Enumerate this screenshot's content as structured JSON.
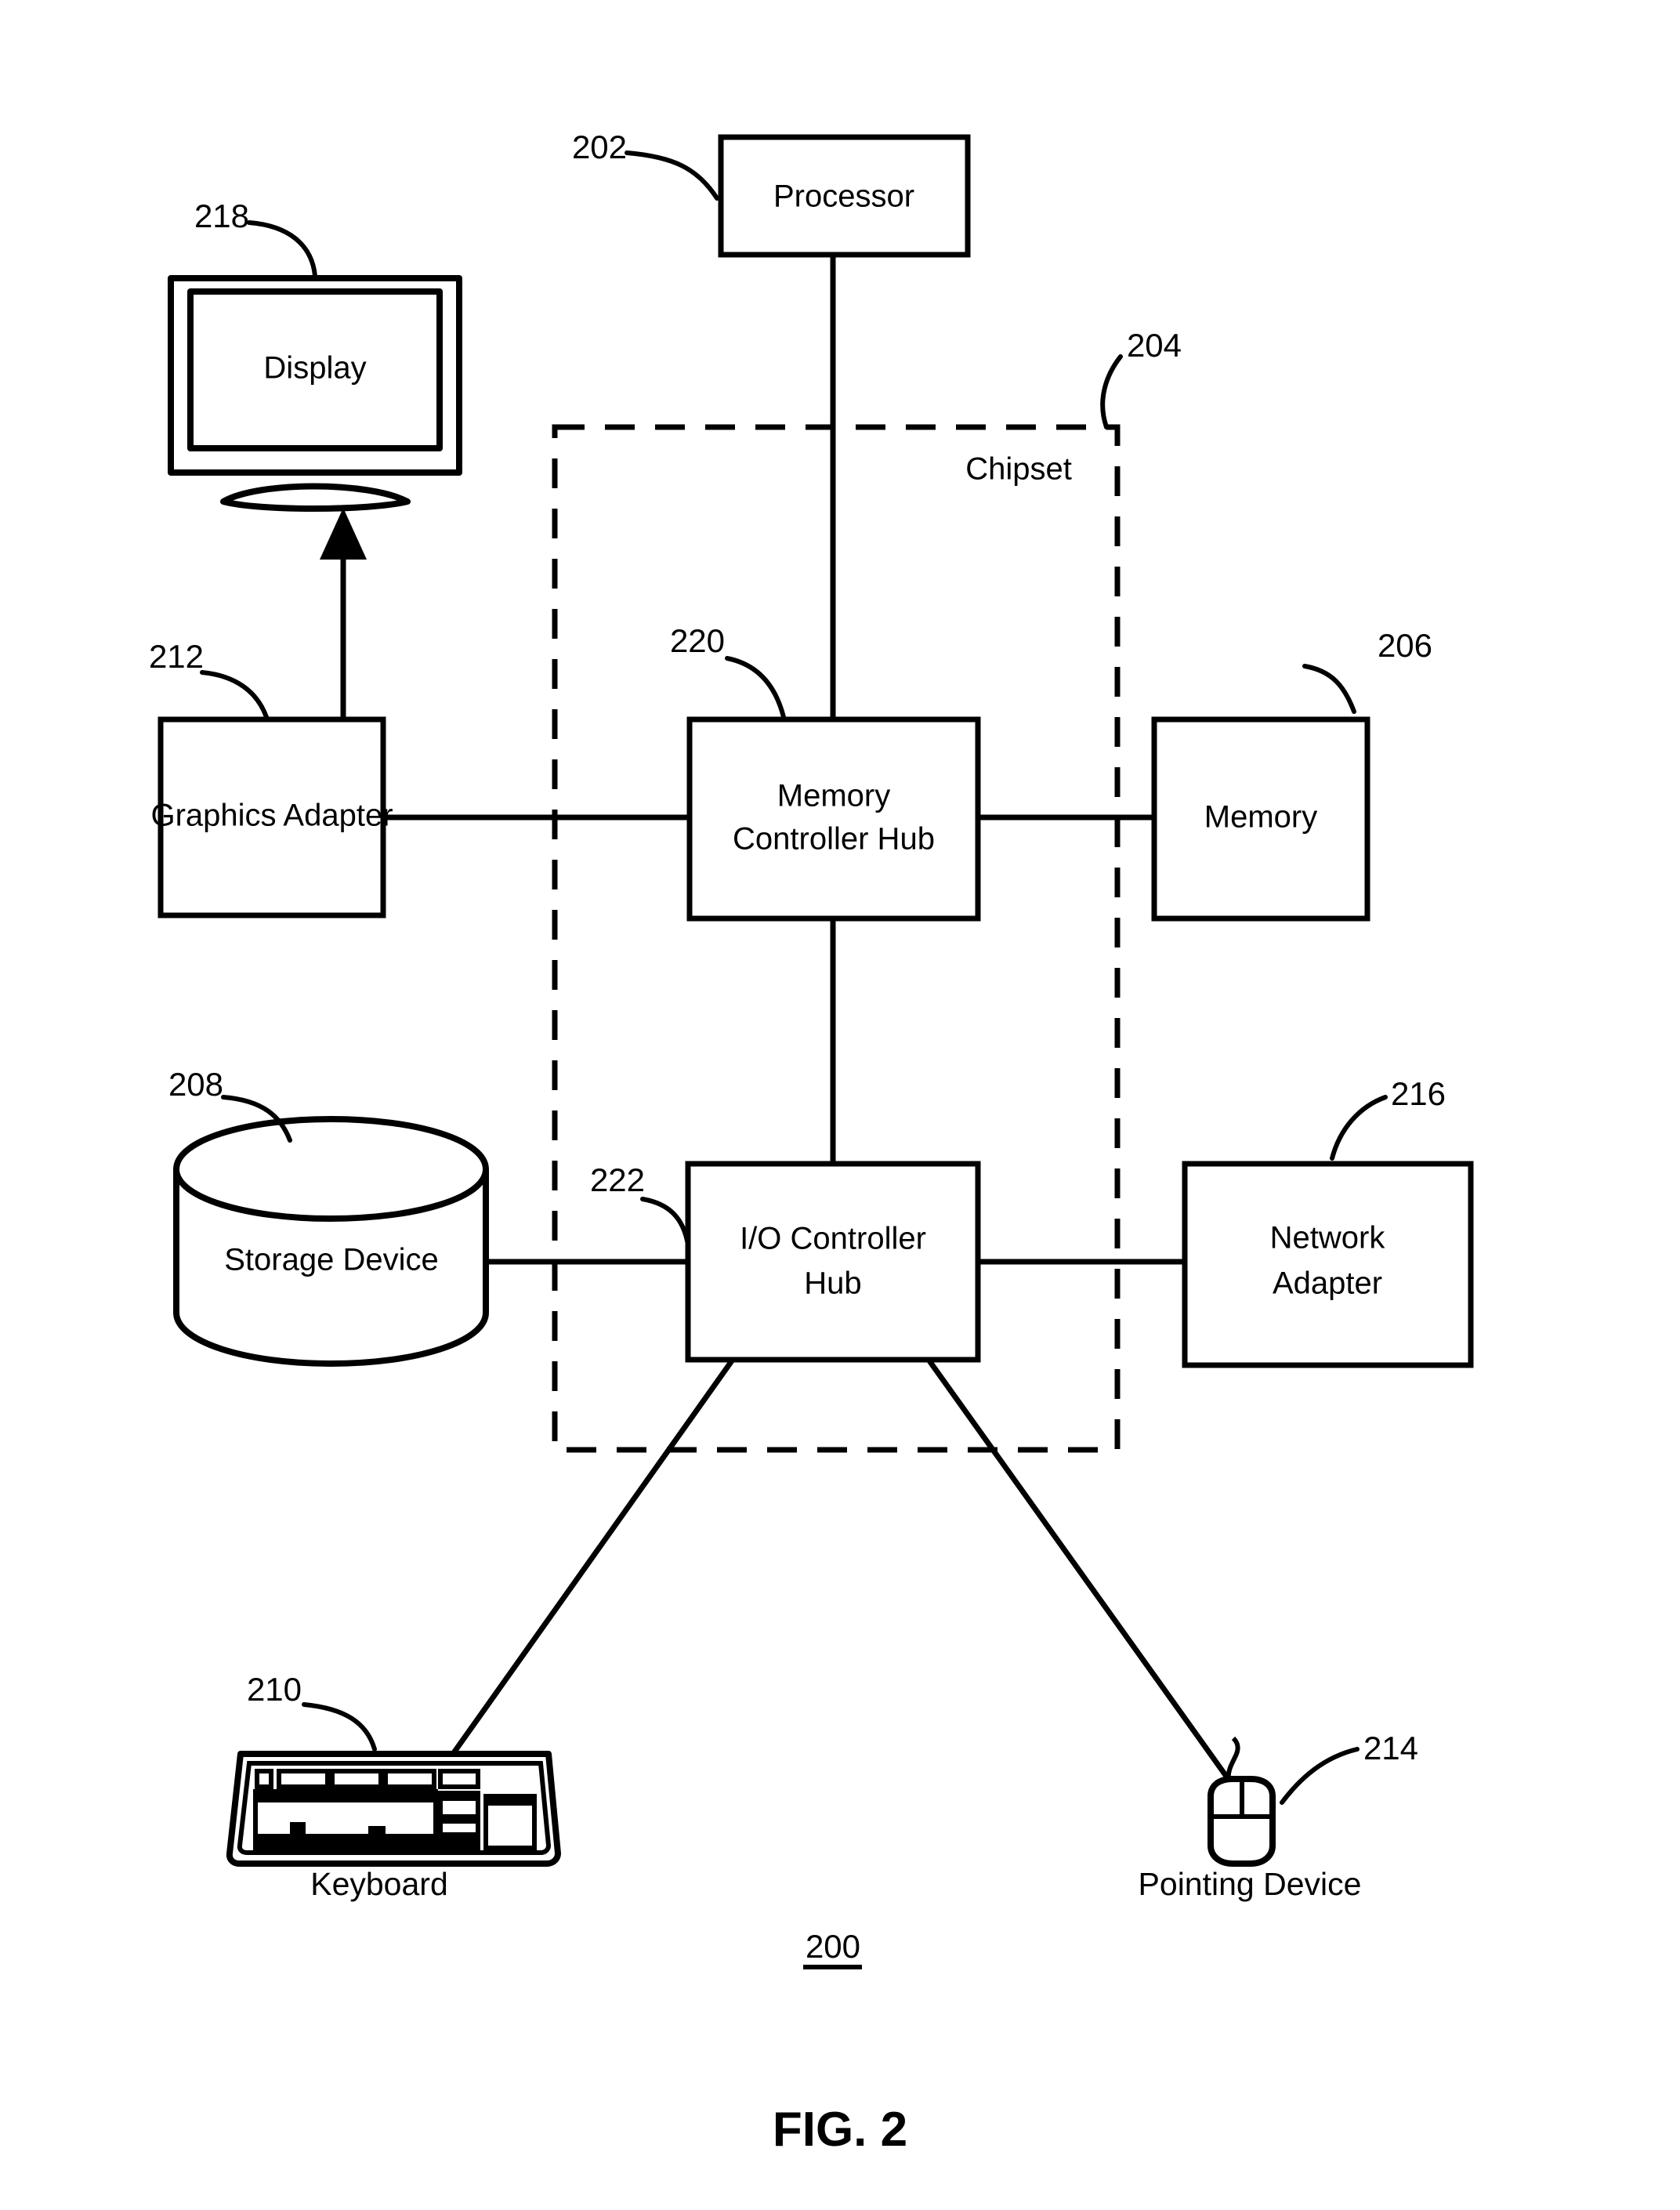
{
  "figure": {
    "title": "FIG. 2",
    "system_ref": "200",
    "caption_keyboard": "Keyboard",
    "caption_pointing_device": "Pointing Device"
  },
  "blocks": {
    "processor": {
      "label": "Processor",
      "ref": "202"
    },
    "chipset": {
      "label": "Chipset",
      "ref": "204"
    },
    "memory": {
      "label": "Memory",
      "ref": "206"
    },
    "storage_device": {
      "label": "Storage Device",
      "ref": "208"
    },
    "keyboard": {
      "label": "Keyboard",
      "ref": "210"
    },
    "graphics_adapter": {
      "label": "Graphics Adapter",
      "ref": "212"
    },
    "pointing_device": {
      "label": "Pointing Device",
      "ref": "214"
    },
    "network_adapter": {
      "label_line1": "Network",
      "label_line2": "Adapter",
      "ref": "216"
    },
    "display": {
      "label": "Display",
      "ref": "218"
    },
    "memory_controller_hub": {
      "label_line1": "Memory",
      "label_line2": "Controller Hub",
      "ref": "220"
    },
    "io_controller_hub": {
      "label_line1": "I/O Controller",
      "label_line2": "Hub",
      "ref": "222"
    }
  },
  "colors": {
    "ink": "#000000",
    "paper": "#ffffff"
  },
  "chart_data": {
    "type": "diagram",
    "title": "FIG. 2",
    "nodes": [
      {
        "id": "202",
        "label": "Processor",
        "shape": "rect"
      },
      {
        "id": "204",
        "label": "Chipset",
        "shape": "dashed-group"
      },
      {
        "id": "206",
        "label": "Memory",
        "shape": "rect"
      },
      {
        "id": "208",
        "label": "Storage Device",
        "shape": "cylinder"
      },
      {
        "id": "210",
        "label": "Keyboard",
        "shape": "keyboard-pictogram"
      },
      {
        "id": "212",
        "label": "Graphics Adapter",
        "shape": "rect"
      },
      {
        "id": "214",
        "label": "Pointing Device",
        "shape": "mouse-pictogram"
      },
      {
        "id": "216",
        "label": "Network Adapter",
        "shape": "rect"
      },
      {
        "id": "218",
        "label": "Display",
        "shape": "monitor-pictogram"
      },
      {
        "id": "220",
        "label": "Memory Controller Hub",
        "shape": "rect"
      },
      {
        "id": "222",
        "label": "I/O Controller Hub",
        "shape": "rect"
      }
    ],
    "edges": [
      {
        "from": "202",
        "to": "220",
        "style": "solid"
      },
      {
        "from": "212",
        "to": "220",
        "style": "solid"
      },
      {
        "from": "220",
        "to": "206",
        "style": "solid"
      },
      {
        "from": "220",
        "to": "222",
        "style": "solid"
      },
      {
        "from": "208",
        "to": "222",
        "style": "solid"
      },
      {
        "from": "222",
        "to": "216",
        "style": "solid"
      },
      {
        "from": "222",
        "to": "210",
        "style": "solid"
      },
      {
        "from": "222",
        "to": "214",
        "style": "solid"
      },
      {
        "from": "212",
        "to": "218",
        "style": "arrow"
      }
    ],
    "groups": [
      {
        "id": "204",
        "label": "Chipset",
        "contains": [
          "220",
          "222"
        ]
      }
    ]
  }
}
